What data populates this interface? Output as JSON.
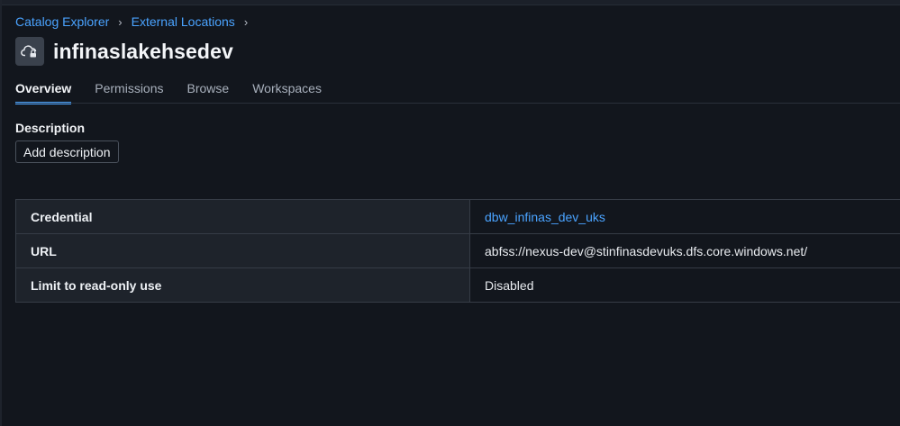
{
  "breadcrumb": {
    "items": [
      {
        "label": "Catalog Explorer"
      },
      {
        "label": "External Locations"
      }
    ],
    "separator": "›"
  },
  "header": {
    "title": "infinaslakehsedev",
    "icon": "cloud-lock-icon"
  },
  "tabs": [
    {
      "label": "Overview",
      "active": true
    },
    {
      "label": "Permissions",
      "active": false
    },
    {
      "label": "Browse",
      "active": false
    },
    {
      "label": "Workspaces",
      "active": false
    }
  ],
  "description": {
    "label": "Description",
    "add_button": "Add description"
  },
  "properties": [
    {
      "key": "Credential",
      "value": "dbw_infinas_dev_uks",
      "is_link": true
    },
    {
      "key": "URL",
      "value": "abfss://nexus-dev@stinfinasdevuks.dfs.core.windows.net/",
      "is_link": false
    },
    {
      "key": "Limit to read-only use",
      "value": "Disabled",
      "is_link": false
    }
  ],
  "colors": {
    "background": "#12161d",
    "accent": "#4aa3ff"
  }
}
